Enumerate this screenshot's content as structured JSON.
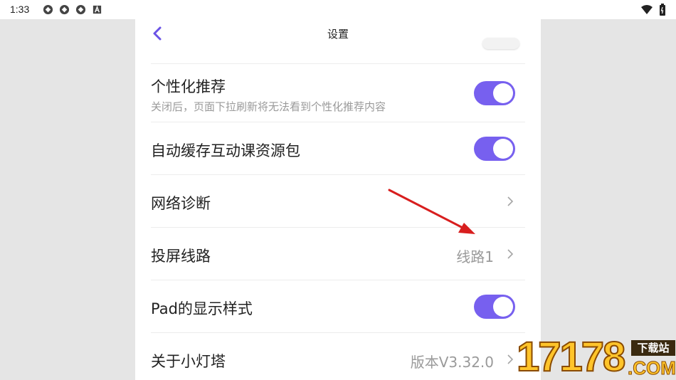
{
  "status_bar": {
    "time": "1:33",
    "icons": [
      "sync-icon",
      "sync-icon",
      "sync-icon",
      "font-a-icon"
    ],
    "right_icons": [
      "wifi-icon",
      "battery-icon"
    ]
  },
  "header": {
    "title": "设置",
    "back_icon": "chevron-left-icon"
  },
  "settings": {
    "personal": {
      "label": "个性化推荐",
      "sub": "关闭后，页面下拉刷新将无法看到个性化推荐内容",
      "enabled": true
    },
    "cache": {
      "label": "自动缓存互动课资源包",
      "enabled": true
    },
    "network": {
      "label": "网络诊断"
    },
    "cast": {
      "label": "投屏线路",
      "value": "线路1"
    },
    "pad": {
      "label": "Pad的显示样式",
      "enabled": true
    },
    "about": {
      "label": "关于小灯塔",
      "value": "版本V3.32.0"
    }
  },
  "watermark": {
    "number": "17178",
    "tag": "下载站",
    "suffix": ".COM"
  },
  "colors": {
    "accent": "#7760ef",
    "annotation_arrow": "#d81e1e",
    "watermark": "#ffc42a"
  }
}
